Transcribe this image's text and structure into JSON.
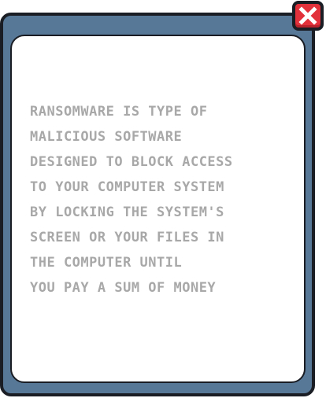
{
  "dialog": {
    "message_lines": [
      "RANSOMWARE IS TYPE OF",
      "MALICIOUS SOFTWARE",
      "DESIGNED TO BLOCK ACCESS",
      "TO YOUR COMPUTER SYSTEM",
      "BY LOCKING THE SYSTEM'S",
      "SCREEN OR YOUR FILES IN",
      "THE COMPUTER UNTIL",
      "YOU PAY A SUM OF MONEY"
    ],
    "close_icon": "close-x-icon"
  },
  "colors": {
    "frame": "#587898",
    "outline": "#1a1e24",
    "panel": "#ffffff",
    "text": "#a8a8a8",
    "close_button": "#e2313a"
  }
}
